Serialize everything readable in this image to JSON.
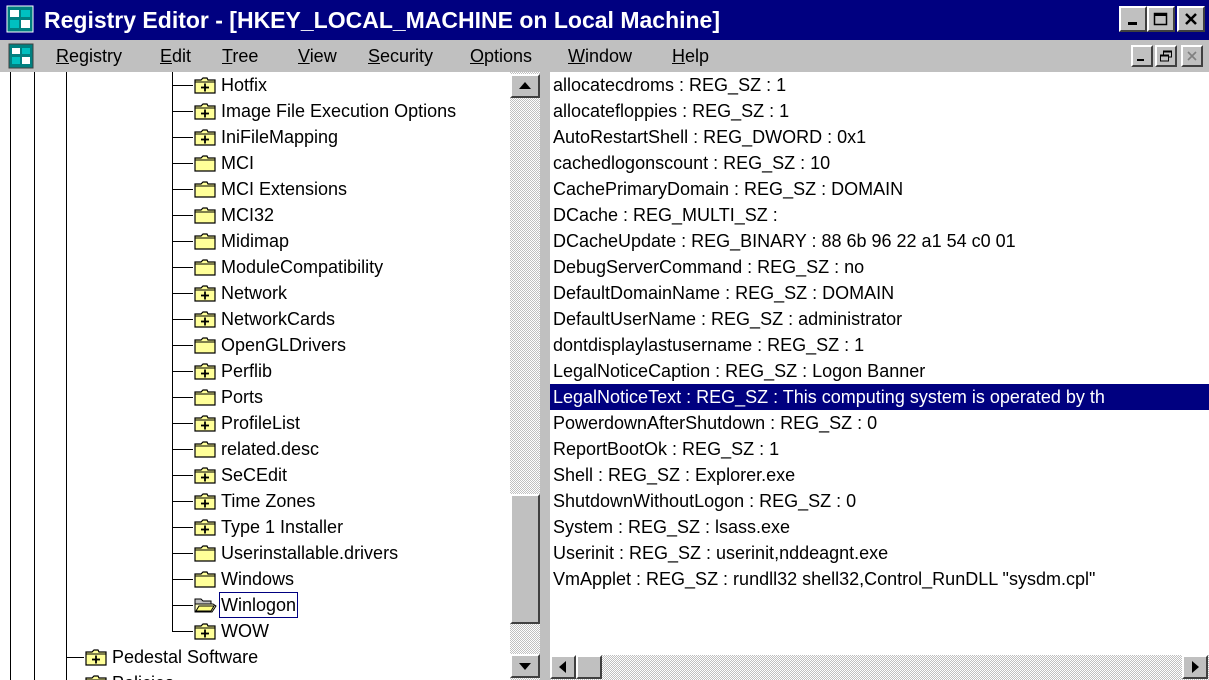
{
  "window": {
    "title": "Registry Editor - [HKEY_LOCAL_MACHINE on Local Machine]",
    "colors": {
      "title_bar": "#000080",
      "face": "#c0c0c0",
      "selection": "#000080"
    }
  },
  "menu": {
    "items": [
      {
        "label": "Registry",
        "accel_index": 0
      },
      {
        "label": "Edit",
        "accel_index": 0
      },
      {
        "label": "Tree",
        "accel_index": 0
      },
      {
        "label": "View",
        "accel_index": 0
      },
      {
        "label": "Security",
        "accel_index": 0
      },
      {
        "label": "Options",
        "accel_index": 0
      },
      {
        "label": "Window",
        "accel_index": 0
      },
      {
        "label": "Help",
        "accel_index": 0
      }
    ]
  },
  "tree": {
    "nodes": [
      {
        "label": "Hotfix",
        "icon": "plus-folder-icon",
        "depth": 1
      },
      {
        "label": "Image File Execution Options",
        "icon": "plus-folder-icon",
        "depth": 1
      },
      {
        "label": "IniFileMapping",
        "icon": "plus-folder-icon",
        "depth": 1
      },
      {
        "label": "MCI",
        "icon": "folder-icon",
        "depth": 1
      },
      {
        "label": "MCI Extensions",
        "icon": "folder-icon",
        "depth": 1
      },
      {
        "label": "MCI32",
        "icon": "folder-icon",
        "depth": 1
      },
      {
        "label": "Midimap",
        "icon": "folder-icon",
        "depth": 1
      },
      {
        "label": "ModuleCompatibility",
        "icon": "folder-icon",
        "depth": 1
      },
      {
        "label": "Network",
        "icon": "plus-folder-icon",
        "depth": 1
      },
      {
        "label": "NetworkCards",
        "icon": "plus-folder-icon",
        "depth": 1
      },
      {
        "label": "OpenGLDrivers",
        "icon": "folder-icon",
        "depth": 1
      },
      {
        "label": "Perflib",
        "icon": "plus-folder-icon",
        "depth": 1
      },
      {
        "label": "Ports",
        "icon": "folder-icon",
        "depth": 1
      },
      {
        "label": "ProfileList",
        "icon": "plus-folder-icon",
        "depth": 1
      },
      {
        "label": "related.desc",
        "icon": "folder-icon",
        "depth": 1
      },
      {
        "label": "SeCEdit",
        "icon": "plus-folder-icon",
        "depth": 1
      },
      {
        "label": "Time Zones",
        "icon": "plus-folder-icon",
        "depth": 1
      },
      {
        "label": "Type 1 Installer",
        "icon": "plus-folder-icon",
        "depth": 1
      },
      {
        "label": "Userinstallable.drivers",
        "icon": "folder-icon",
        "depth": 1
      },
      {
        "label": "Windows",
        "icon": "folder-icon",
        "depth": 1
      },
      {
        "label": "Winlogon",
        "icon": "open-folder-icon",
        "depth": 1,
        "selected": true
      },
      {
        "label": "WOW",
        "icon": "plus-folder-icon",
        "depth": 1
      },
      {
        "label": "Pedestal Software",
        "icon": "plus-folder-icon",
        "depth": 0
      },
      {
        "label": "Policies",
        "icon": "plus-folder-icon",
        "depth": 0
      }
    ]
  },
  "values": {
    "rows": [
      {
        "text": "allocatecdroms : REG_SZ : 1"
      },
      {
        "text": "allocatefloppies : REG_SZ : 1"
      },
      {
        "text": "AutoRestartShell : REG_DWORD : 0x1"
      },
      {
        "text": "cachedlogonscount : REG_SZ : 10"
      },
      {
        "text": "CachePrimaryDomain : REG_SZ : DOMAIN"
      },
      {
        "text": "DCache : REG_MULTI_SZ :"
      },
      {
        "text": "DCacheUpdate : REG_BINARY : 88 6b 96 22 a1 54 c0 01"
      },
      {
        "text": "DebugServerCommand : REG_SZ : no"
      },
      {
        "text": "DefaultDomainName : REG_SZ : DOMAIN"
      },
      {
        "text": "DefaultUserName : REG_SZ : administrator"
      },
      {
        "text": "dontdisplaylastusername : REG_SZ : 1"
      },
      {
        "text": "LegalNoticeCaption : REG_SZ : Logon Banner"
      },
      {
        "text": "LegalNoticeText : REG_SZ : This computing system is operated by th",
        "selected": true
      },
      {
        "text": "PowerdownAfterShutdown : REG_SZ : 0"
      },
      {
        "text": "ReportBootOk : REG_SZ : 1"
      },
      {
        "text": "Shell : REG_SZ : Explorer.exe"
      },
      {
        "text": "ShutdownWithoutLogon : REG_SZ : 0"
      },
      {
        "text": "System : REG_SZ : lsass.exe"
      },
      {
        "text": "Userinit : REG_SZ : userinit,nddeagnt.exe"
      },
      {
        "text": "VmApplet : REG_SZ : rundll32 shell32,Control_RunDLL \"sysdm.cpl\""
      }
    ]
  },
  "scroll": {
    "tree_vertical_position": 0.93,
    "values_horizontal_position": 0.0
  }
}
